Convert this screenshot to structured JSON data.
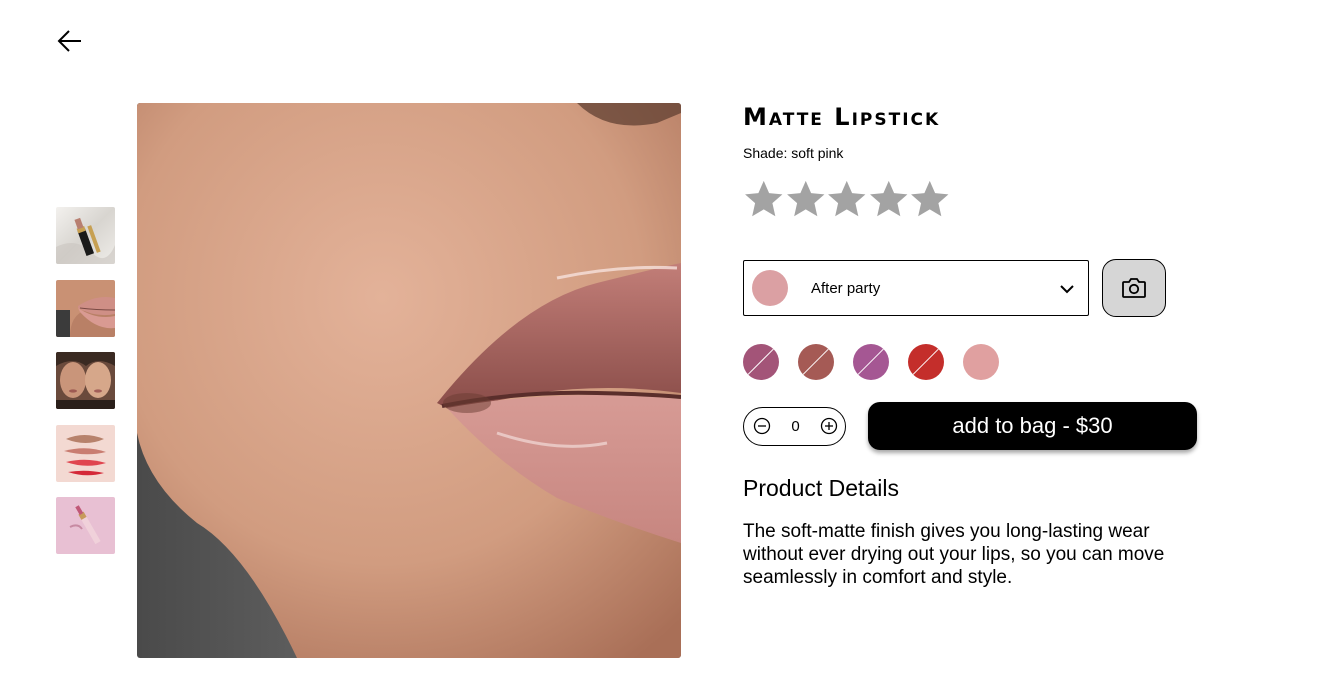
{
  "product": {
    "title": "Matte Lipstick",
    "shade_prefix": "Shade: ",
    "shade_value": "soft pink",
    "rating": 0,
    "rating_max": 5,
    "star_color": "#a3a3a3"
  },
  "shade_selector": {
    "selected_label": "After party",
    "selected_color": "#dba0a3"
  },
  "swatches": [
    {
      "color": "#a35478",
      "unavailable": true
    },
    {
      "color": "#a55a55",
      "unavailable": true
    },
    {
      "color": "#a55793",
      "unavailable": true
    },
    {
      "color": "#c42e2b",
      "unavailable": true
    },
    {
      "color": "#e0a0a0",
      "unavailable": false
    }
  ],
  "quantity": {
    "value": "0"
  },
  "cart": {
    "add_label": "add to bag - $30"
  },
  "details": {
    "heading": "Product Details",
    "body": "The soft-matte finish gives you long-lasting wear without ever drying out your lips, so you can move seamlessly in comfort and style."
  },
  "gallery": {
    "thumbnails": [
      {
        "name": "lipstick-bullet-on-silk"
      },
      {
        "name": "lips-closeup"
      },
      {
        "name": "two-models-portrait"
      },
      {
        "name": "swatch-smears"
      },
      {
        "name": "lipstick-on-pink"
      }
    ]
  },
  "icons": {
    "back": "arrow-left-icon",
    "chevron": "chevron-down-icon",
    "camera": "camera-icon",
    "minus": "minus-circle-icon",
    "plus": "plus-circle-icon",
    "star": "star-icon"
  }
}
